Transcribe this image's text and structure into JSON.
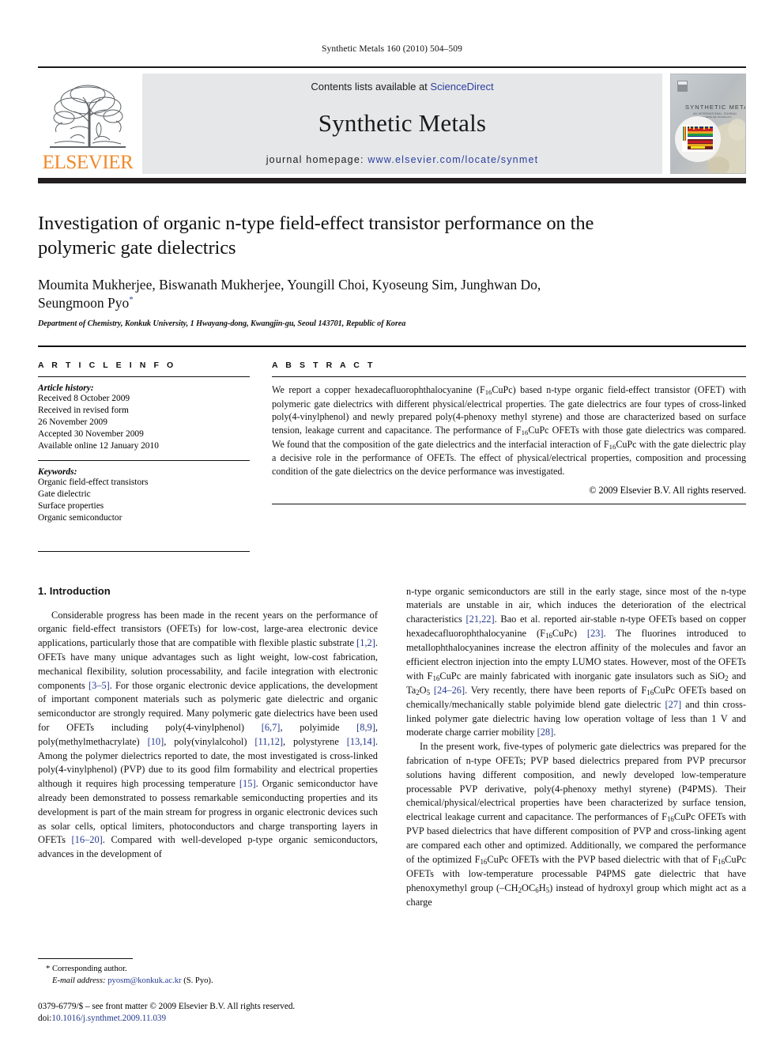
{
  "running_head": "Synthetic Metals 160 (2010) 504–509",
  "masthead": {
    "publisher_name": "ELSEVIER",
    "contents_prefix": "Contents lists available at",
    "contents_link": "ScienceDirect",
    "journal_title": "Synthetic Metals",
    "homepage_prefix": "journal homepage:",
    "homepage_url": "www.elsevier.com/locate/synmet",
    "cover_title": "SYNTHETIC METALS",
    "link_color": "#2b3ea0",
    "band_color": "#e6e7e8",
    "elsevier_orange": "#f0892a"
  },
  "article": {
    "title": "Investigation of organic n-type field-effect transistor performance on the polymeric gate dielectrics",
    "authors": "Moumita Mukherjee, Biswanath Mukherjee, Youngill Choi, Kyoseung Sim, Junghwan Do, Seungmoon Pyo",
    "corresponding_marker": "*",
    "affiliation": "Department of Chemistry, Konkuk University, 1 Hwayang-dong, Kwangjin-gu, Seoul 143701, Republic of Korea"
  },
  "article_info": {
    "heading": "A R T I C L E   I N F O",
    "history_label": "Article history:",
    "history": [
      "Received 8 October 2009",
      "Received in revised form",
      "26 November 2009",
      "Accepted 30 November 2009",
      "Available online 12 January 2010"
    ],
    "keywords_label": "Keywords:",
    "keywords": [
      "Organic field-effect transistors",
      "Gate dielectric",
      "Surface properties",
      "Organic semiconductor"
    ]
  },
  "abstract": {
    "heading": "A B S T R A C T",
    "paragraphs": [
      "We report a copper hexadecafluorophthalocyanine (F16CuPc) based n-type organic field-effect transistor (OFET) with polymeric gate dielectrics with different physical/electrical properties. The gate dielectrics are four types of cross-linked poly(4-vinylphenol) and newly prepared poly(4-phenoxy methyl styrene) and those are characterized based on surface tension, leakage current and capacitance. The performance of F16CuPc OFETs with those gate dielectrics was compared. We found that the composition of the gate dielectrics and the interfacial interaction of F16CuPc with the gate dielectric play a decisive role in the performance of OFETs. The effect of physical/electrical properties, composition and processing condition of the gate dielectrics on the device performance was investigated."
    ],
    "copyright": "© 2009 Elsevier B.V. All rights reserved."
  },
  "body": {
    "section_number_title": "1.  Introduction",
    "left_paragraphs": [
      "Considerable progress has been made in the recent years on the performance of organic field-effect transistors (OFETs) for low-cost, large-area electronic device applications, particularly those that are compatible with flexible plastic substrate [1,2]. OFETs have many unique advantages such as light weight, low-cost fabrication, mechanical flexibility, solution processability, and facile integration with electronic components [3–5]. For those organic electronic device applications, the development of important component materials such as polymeric gate dielectric and organic semiconductor are strongly required. Many polymeric gate dielectrics have been used for OFETs including poly(4-vinylphenol) [6,7], polyimide [8,9], poly(methylmethacrylate) [10], poly(vinylalcohol) [11,12], polystyrene [13,14]. Among the polymer dielectrics reported to date, the most investigated is cross-linked poly(4-vinylphenol) (PVP) due to its good film formability and electrical properties although it requires high processing temperature [15]. Organic semiconductor have already been demonstrated to possess remarkable semiconducting properties and its development is part of the main stream for progress in organic electronic devices such as solar cells, optical limiters, photoconductors and charge transporting layers in OFETs [16–20]. Compared with well-developed p-type organic semiconductors, advances in the development of"
    ],
    "right_paragraphs": [
      "n-type organic semiconductors are still in the early stage, since most of the n-type materials are unstable in air, which induces the deterioration of the electrical characteristics [21,22]. Bao et al. reported air-stable n-type OFETs based on copper hexadecafluorophthalocyanine (F16CuPc) [23]. The fluorines introduced to metallophthalocyanines increase the electron affinity of the molecules and favor an efficient electron injection into the empty LUMO states. However, most of the OFETs with F16CuPc are mainly fabricated with inorganic gate insulators such as SiO2 and Ta2O5 [24–26]. Very recently, there have been reports of F16CuPc OFETs based on chemically/mechanically stable polyimide blend gate dielectric [27] and thin cross-linked polymer gate dielectric having low operation voltage of less than 1 V and moderate charge carrier mobility [28].",
      "In the present work, five-types of polymeric gate dielectrics was prepared for the fabrication of n-type OFETs; PVP based dielectrics prepared from PVP precursor solutions having different composition, and newly developed low-temperature processable PVP derivative, poly(4-phenoxy methyl styrene) (P4PMS). Their chemical/physical/electrical properties have been characterized by surface tension, electrical leakage current and capacitance. The performances of F16CuPc OFETs with PVP based dielectrics that have different composition of PVP and cross-linking agent are compared each other and optimized. Additionally, we compared the performance of the optimized F16CuPc OFETs with the PVP based dielectric with that of F16CuPc OFETs with low-temperature processable P4PMS gate dielectric that have phenoxymethyl group (–CH2OC6H5) instead of hydroxyl group which might act as a charge"
    ]
  },
  "footer": {
    "corresponding_label": "* Corresponding author.",
    "email_label": "E-mail address:",
    "email": "pyosm@konkuk.ac.kr",
    "email_suffix": "(S. Pyo).",
    "issn_line": "0379-6779/$ – see front matter © 2009 Elsevier B.V. All rights reserved.",
    "doi_label": "doi:",
    "doi_value": "10.1016/j.synthmet.2009.11.039"
  }
}
